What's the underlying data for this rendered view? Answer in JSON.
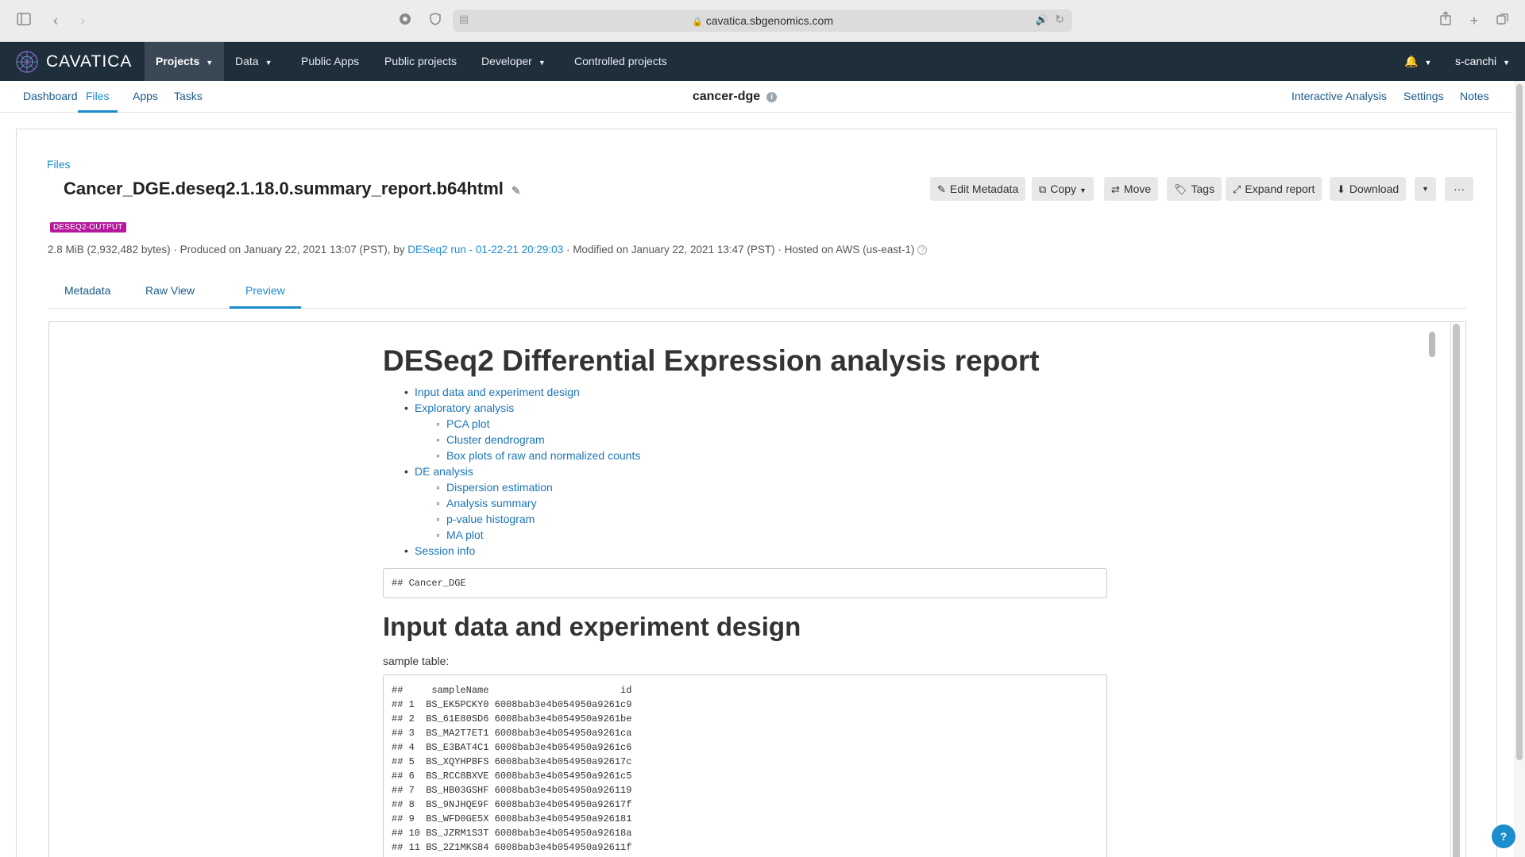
{
  "browser": {
    "url": "cavatica.sbgenomics.com",
    "icons": [
      "sidebar-icon",
      "back-icon",
      "forward-icon",
      "share-icon",
      "new-tab-icon",
      "tabs-icon"
    ]
  },
  "navbar": {
    "brand": "CAVATICA",
    "items": [
      {
        "label": "Projects",
        "caret": true,
        "active": true
      },
      {
        "label": "Data",
        "caret": true
      },
      {
        "label": "Public Apps"
      },
      {
        "label": "Public projects"
      },
      {
        "label": "Developer",
        "caret": true
      },
      {
        "label": "Controlled projects"
      }
    ],
    "user": "s-canchi"
  },
  "subnav": {
    "left": [
      "Dashboard",
      "Files",
      "Apps",
      "Tasks"
    ],
    "active": "Files",
    "project": "cancer-dge",
    "right": [
      "Interactive Analysis",
      "Settings",
      "Notes"
    ]
  },
  "file": {
    "breadcrumb": "Files",
    "title": "Cancer_DGE.deseq2.1.18.0.summary_report.b64html",
    "tag": "DESEQ2-OUTPUT",
    "size": "2.8 MiB (2,932,482 bytes)",
    "produced": "Produced on January 22, 2021 13:07 (PST), by",
    "produced_by": "DESeq2 run - 01-22-21 20:29:03",
    "modified": "Modified on January 22, 2021 13:47 (PST)",
    "hosted": "Hosted on AWS (us-east-1)",
    "actions": {
      "edit_metadata": "Edit Metadata",
      "copy": "Copy",
      "move": "Move",
      "tags": "Tags",
      "expand": "Expand report",
      "download": "Download",
      "more": "···"
    }
  },
  "tabs": [
    "Metadata",
    "Raw View",
    "Preview"
  ],
  "active_tab": "Preview",
  "report": {
    "title": "DESeq2 Differential Expression analysis report",
    "toc": [
      {
        "label": "Input data and experiment design",
        "level": 1
      },
      {
        "label": "Exploratory analysis",
        "level": 1
      },
      {
        "label": "PCA plot",
        "level": 2
      },
      {
        "label": "Cluster dendrogram",
        "level": 2
      },
      {
        "label": "Box plots of raw and normalized counts",
        "level": 2
      },
      {
        "label": "DE analysis",
        "level": 1
      },
      {
        "label": "Dispersion estimation",
        "level": 2
      },
      {
        "label": "Analysis summary",
        "level": 2
      },
      {
        "label": "p-value histogram",
        "level": 2
      },
      {
        "label": "MA plot",
        "level": 2
      },
      {
        "label": "Session info",
        "level": 1
      }
    ],
    "name_code": "## Cancer_DGE",
    "section_title": "Input data and experiment design",
    "sample_label": "sample table:",
    "sample_table": [
      "##     sampleName                       id",
      "## 1  BS_EK5PCKY0 6008bab3e4b054950a9261c9",
      "## 2  BS_61E80SD6 6008bab3e4b054950a9261be",
      "## 3  BS_MA2T7ET1 6008bab3e4b054950a9261ca",
      "## 4  BS_E3BAT4C1 6008bab3e4b054950a9261c6",
      "## 5  BS_XQYHPBFS 6008bab3e4b054950a92617c",
      "## 6  BS_RCC8BXVE 6008bab3e4b054950a9261c5",
      "## 7  BS_HB03GSHF 6008bab3e4b054950a926119",
      "## 8  BS_9NJHQE9F 6008bab3e4b054950a92617f",
      "## 9  BS_WFD0GE5X 6008bab3e4b054950a926181",
      "## 10 BS_JZRM1S3T 6008bab3e4b054950a92618a",
      "## 11 BS_2Z1MKS84 6008bab3e4b054950a92611f"
    ]
  },
  "help": "?"
}
